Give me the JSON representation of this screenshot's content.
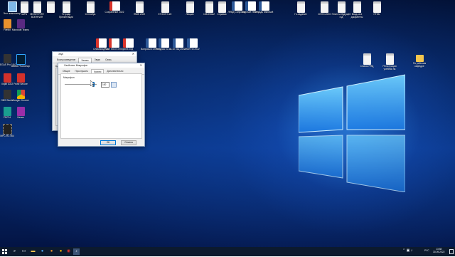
{
  "desktop": {
    "top_icons": [
      {
        "label": "Этот компьютер",
        "glyph": "pc-icon",
        "style": "g-pc"
      },
      {
        "label": "4АРА",
        "glyph": "file-icon",
        "style": "g-file"
      },
      {
        "label": "МОНИТРИЯ ВОЕННАЯ",
        "glyph": "file-icon",
        "style": "g-file"
      },
      {
        "label": "",
        "glyph": "file-icon",
        "style": "g-file"
      },
      {
        "label": "Тетрадь Презентации",
        "glyph": "file-icon",
        "style": "g-file"
      },
      {
        "label": "Сентябрь",
        "glyph": "file-icon",
        "style": "g-file"
      },
      {
        "label": "Сохранение 2022",
        "glyph": "pdf-icon",
        "style": "g-pdf"
      },
      {
        "label": "ПМЖ 2022",
        "glyph": "file-icon",
        "style": "g-file"
      },
      {
        "label": "ЕГЭ/ОГЭ-22",
        "glyph": "file-icon",
        "style": "g-file"
      },
      {
        "label": "Лекция",
        "glyph": "file-icon",
        "style": "g-file"
      },
      {
        "label": "10B-ЕКШ2",
        "glyph": "file-icon",
        "style": "g-file"
      },
      {
        "label": "Справка",
        "glyph": "file-icon",
        "style": "g-file"
      },
      {
        "label": "ЛФВД Сопровод",
        "glyph": "doc-icon",
        "style": "g-doc"
      },
      {
        "label": "Microsoft Teams",
        "glyph": "doc-icon",
        "style": "g-doc"
      },
      {
        "label": "Тетрадь Microsoft",
        "glyph": "doc-icon",
        "style": "g-doc"
      },
      {
        "label": "Гo-задание",
        "glyph": "file-icon",
        "style": "g-file"
      },
      {
        "label": "СЕНЭ-2023",
        "glyph": "file-icon",
        "style": "g-file"
      },
      {
        "label": "План на будущее год",
        "glyph": "file-icon",
        "style": "g-file"
      },
      {
        "label": "Вход-ка в документы",
        "glyph": "file-icon",
        "style": "g-file"
      },
      {
        "label": "HTML",
        "glyph": "file-icon",
        "style": "g-file"
      }
    ],
    "left_icons": [
      {
        "label": "Firefox",
        "glyph": "firefox-icon",
        "style": "g-orange"
      },
      {
        "label": "Microsoft Teams",
        "glyph": "teams-icon",
        "style": "g-purple"
      },
      {
        "label": "VEGAS Pro 18.0",
        "glyph": "vegas-icon",
        "style": "g-dark"
      },
      {
        "label": "Adobe Photoshop",
        "glyph": "photoshop-icon",
        "style": "g-ps"
      },
      {
        "label": "Xsplit 2022",
        "glyph": "xsplit-icon",
        "style": "g-red"
      },
      {
        "label": "Pulse Secure",
        "glyph": "pulse-icon",
        "style": "g-red"
      },
      {
        "label": "OBS Studio",
        "glyph": "obs-icon",
        "style": "g-dark"
      },
      {
        "label": "Google Chrome",
        "glyph": "chrome-icon",
        "style": "g-chrome"
      },
      {
        "label": "PDF24",
        "glyph": "pdf24-icon",
        "style": "g-teal"
      },
      {
        "label": "Viewer",
        "glyph": "viewer-icon",
        "style": "g-magenta"
      },
      {
        "label": "MPC-HC x64",
        "glyph": "film-icon",
        "style": "g-film"
      }
    ],
    "mid_icons": [
      {
        "label": "Олимпиадные задания",
        "glyph": "pdf-icon",
        "style": "g-pdf"
      },
      {
        "label": "Pulse Sit-5 в ИЗО",
        "glyph": "pdf-icon",
        "style": "g-pdf"
      },
      {
        "label": "jobek 10д",
        "glyph": "pdf-icon",
        "style": "g-pdf"
      },
      {
        "label": "Вопросы и ответы",
        "glyph": "doc-icon",
        "style": "g-doc"
      },
      {
        "label": "Ресурсы 10-11",
        "glyph": "doc-icon",
        "style": "g-doc"
      },
      {
        "label": "8-10 лиц 2022",
        "glyph": "doc-icon",
        "style": "g-doc"
      },
      {
        "label": "ЗАЧЁТЫ 2022",
        "glyph": "doc-icon",
        "style": "g-doc"
      }
    ],
    "right_icons": [
      {
        "label": "Список РФД",
        "glyph": "file-icon",
        "style": "g-file"
      },
      {
        "label": "Регистрация учебник на",
        "glyph": "file-icon",
        "style": "g-file"
      },
      {
        "label": "По рабочим кафедре",
        "glyph": "folder-icon",
        "style": "g-folder"
      }
    ]
  },
  "sound_dialog": {
    "title": "Звук",
    "tabs": [
      "Воспроизведение",
      "Запись",
      "Звуки",
      "Связь"
    ],
    "description": "Выберите устройство записи, параметры которого нужно изменить:",
    "ok_label": "ОК"
  },
  "mic_dialog": {
    "title": "Свойства: Микрофон",
    "tabs": [
      "Общие",
      "Прослушать",
      "Уровни",
      "Дополнительно"
    ],
    "active_tab": "Уровни",
    "level_label": "Микрофон",
    "level_value": "100",
    "slider_fraction": 0.9,
    "ok_label": "ОК",
    "cancel_label": "Отмена"
  },
  "taskbar": {
    "tray_time": "13:58",
    "tray_date": "30.09.2022",
    "tray_lang": "РУС"
  },
  "colors": {
    "accent": "#0078d7",
    "wallpaper": "#05245f",
    "taskbar": "#0c1a2e"
  }
}
